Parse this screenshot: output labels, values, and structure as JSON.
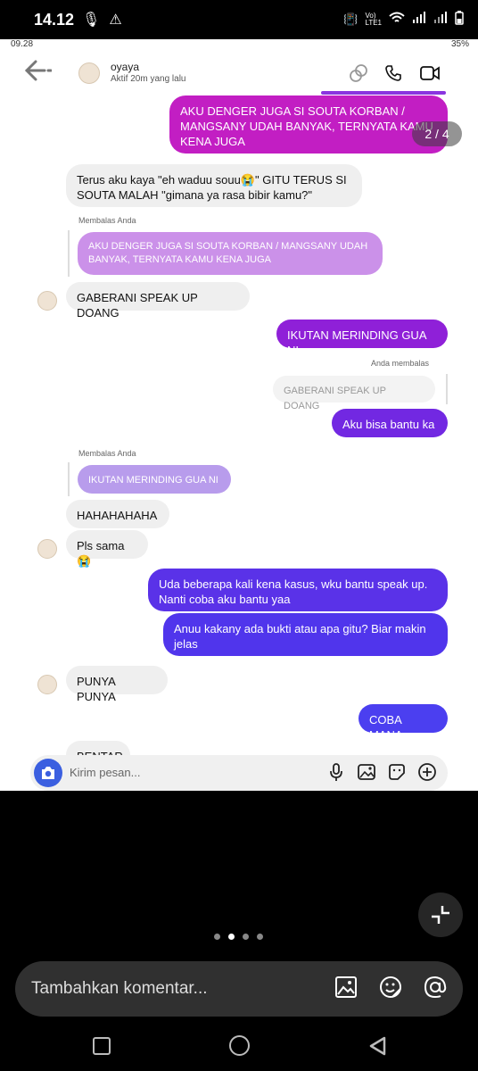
{
  "outer_status": {
    "time": "14.12"
  },
  "inner_status": {
    "time": "09.28",
    "battery": "35%"
  },
  "header": {
    "name": "oyaya",
    "status": "Aktif 20m yang lalu"
  },
  "counter": "2 / 4",
  "messages": {
    "m1": "AKU DENGER JUGA SI SOUTA KORBAN / MANGSANY UDAH BANYAK, TERNYATA KAMU KENA JUGA",
    "m2": "Terus aku kaya \"eh waduu souu😭\" GITU TERUS SI SOUTA MALAH \"gimana ya rasa bibir kamu?\"",
    "m2_label": "Membalas Anda",
    "m2_reply": "AKU DENGER JUGA SI SOUTA KORBAN / MANGSANY UDAH BANYAK, TERNYATA KAMU KENA JUGA",
    "m3": "GABERANI SPEAK UP DOANG",
    "m4": "IKUTAN MERINDING GUA NI",
    "m5_label": "Anda membalas",
    "m5_reply": "GABERANI SPEAK UP DOANG",
    "m5": "Aku bisa bantu ka",
    "m6_label": "Membalas Anda",
    "m6_reply": "IKUTAN MERINDING GUA NI",
    "m6": "HAHAHAHAHA",
    "m7": "Pls sama😭",
    "m8": "Uda beberapa kali kena kasus, wku bantu speak up. Nanti coba aku bantu yaa",
    "m9": "Anuu kakany ada bukti atau apa gitu? Biar makin jelas",
    "m10": "PUNYA PUNYA",
    "m11": "COBA MANA",
    "m12": "BENTAR"
  },
  "input_placeholder": "Kirim pesan...",
  "comment_placeholder": "Tambahkan komentar...",
  "colors": {
    "accent": "#3b5fe0",
    "out_top": "#c21ec3",
    "out_bottom": "#4b3ff0"
  }
}
